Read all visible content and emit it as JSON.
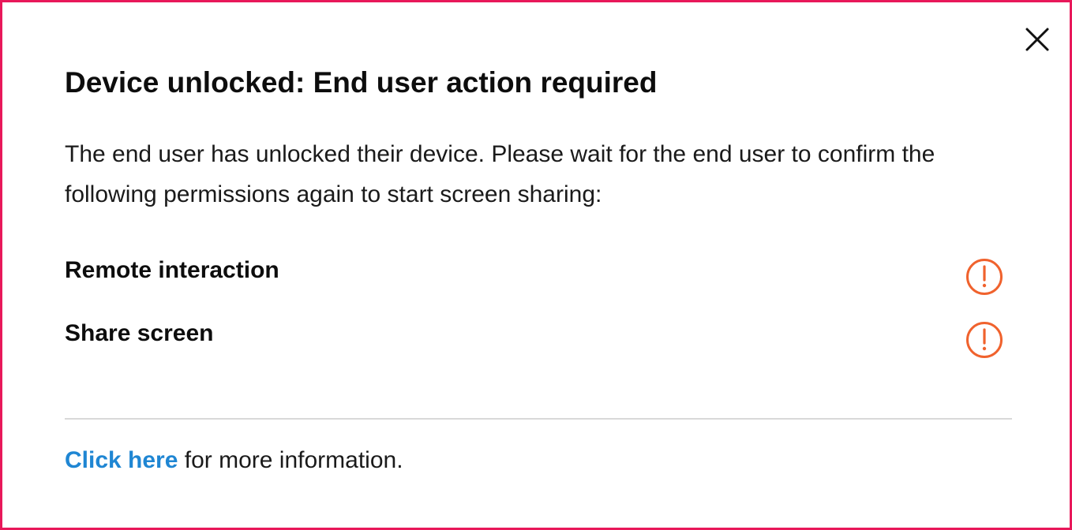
{
  "dialog": {
    "title": "Device unlocked: End user action required",
    "description": "The end user has unlocked their device. Please wait for the end user to confirm the following permissions again to start screen sharing:",
    "close_icon": "close-icon",
    "permissions": [
      {
        "label": "Remote interaction",
        "status_icon": "warning-icon",
        "status": "pending"
      },
      {
        "label": "Share screen",
        "status_icon": "warning-icon",
        "status": "pending"
      }
    ],
    "footer": {
      "link_label": "Click here",
      "suffix": " for more information."
    }
  },
  "colors": {
    "border": "#e8185a",
    "warning": "#f0622d",
    "link": "#1f86d3",
    "divider": "#d9d9d9"
  }
}
